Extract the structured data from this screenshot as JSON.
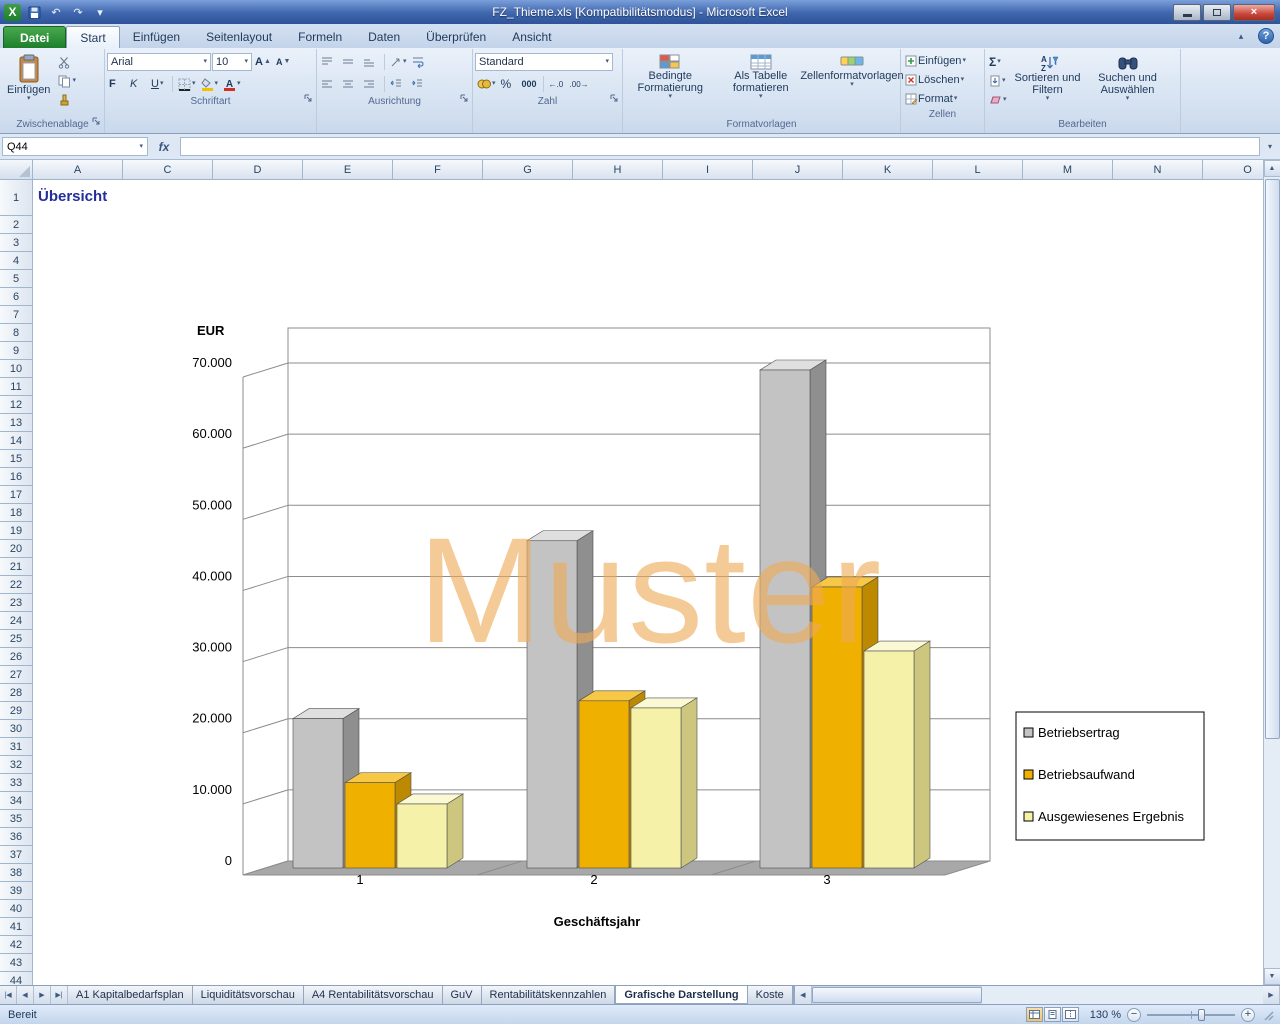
{
  "window": {
    "title": "FZ_Thieme.xls  [Kompatibilitätsmodus] - Microsoft Excel"
  },
  "glyphs": {
    "dropdown": "▾",
    "up": "▲",
    "down": "▼",
    "left": "◀",
    "right": "▶",
    "tab_first": "|◀",
    "tab_prev": "◀",
    "tab_next": "▶",
    "tab_last": "▶|",
    "undo": "↶",
    "redo": "↷",
    "help": "?",
    "close": "×",
    "sigma": "Σ",
    "caret_up": "▴"
  },
  "ribbon": {
    "file_tab": "Datei",
    "tabs": [
      "Start",
      "Einfügen",
      "Seitenlayout",
      "Formeln",
      "Daten",
      "Überprüfen",
      "Ansicht"
    ],
    "active_tab": "Start",
    "groups": {
      "clipboard": {
        "label": "Zwischenablage",
        "paste_label": "Einfügen"
      },
      "font": {
        "label": "Schriftart",
        "font_name": "Arial",
        "font_size": "10",
        "bold": "F",
        "italic": "K",
        "underline": "U",
        "grow": "A",
        "shrink": "A"
      },
      "alignment": {
        "label": "Ausrichtung"
      },
      "number": {
        "label": "Zahl",
        "format": "Standard",
        "percent": "%",
        "thousands": "000",
        "inc_decimal": "←.0",
        "dec_decimal": ".00→"
      },
      "styles": {
        "label": "Formatvorlagen",
        "conditional": "Bedingte Formatierung",
        "as_table": "Als Tabelle formatieren",
        "cell_styles": "Zellenformatvorlagen"
      },
      "cells": {
        "label": "Zellen",
        "insert": "Einfügen",
        "delete": "Löschen",
        "format": "Format"
      },
      "editing": {
        "label": "Bearbeiten",
        "sort": "Sortieren und Filtern",
        "find": "Suchen und Auswählen"
      }
    }
  },
  "formula_bar": {
    "name_box": "Q44",
    "fx": "fx",
    "formula": ""
  },
  "grid": {
    "columns": [
      "A",
      "C",
      "D",
      "E",
      "F",
      "G",
      "H",
      "I",
      "J",
      "K",
      "L",
      "M",
      "N",
      "O"
    ],
    "row_count": 44,
    "cell_a1": "Übersicht"
  },
  "chart_data": {
    "type": "bar",
    "subtype": "3d-column",
    "title": "",
    "ylabel": "EUR",
    "xlabel": "Geschäftsjahr",
    "categories": [
      "1",
      "2",
      "3"
    ],
    "series": [
      {
        "name": "Betriebsertrag",
        "color": "#c3c3c3",
        "color_top": "#dfdfdf",
        "color_side": "#8f8f8f",
        "values": [
          21000,
          46000,
          70000
        ]
      },
      {
        "name": "Betriebsaufwand",
        "color": "#f0b000",
        "color_top": "#f6c845",
        "color_side": "#bd8900",
        "values": [
          12000,
          23500,
          39500
        ]
      },
      {
        "name": "Ausgewiesenes Ergebnis",
        "color": "#f5f1a9",
        "color_top": "#fbf9d3",
        "color_side": "#ccc67e",
        "values": [
          9000,
          22500,
          30500
        ]
      }
    ],
    "ylim": [
      0,
      70000
    ],
    "ytick_step": 10000,
    "ytick_labels": [
      "0",
      "10.000",
      "20.000",
      "30.000",
      "40.000",
      "50.000",
      "60.000",
      "70.000"
    ],
    "legend_position": "right",
    "grid": true,
    "watermark": "Muster",
    "style": {
      "wall": "#ffffff",
      "grid_color": "#8c8c8c",
      "floor": "#a8a8a8",
      "bar_stroke": "#4d4d4d",
      "watermark_color": "#eeab57"
    }
  },
  "sheet_tabs": {
    "tabs": [
      "A1 Kapitalbedarfsplan",
      "Liquiditätsvorschau",
      "A4 Rentabilitätsvorschau",
      "GuV",
      "Rentabilitätskennzahlen",
      "Grafische Darstellung",
      "Koste"
    ],
    "active": "Grafische Darstellung"
  },
  "status_bar": {
    "status": "Bereit",
    "zoom": "130 %"
  }
}
